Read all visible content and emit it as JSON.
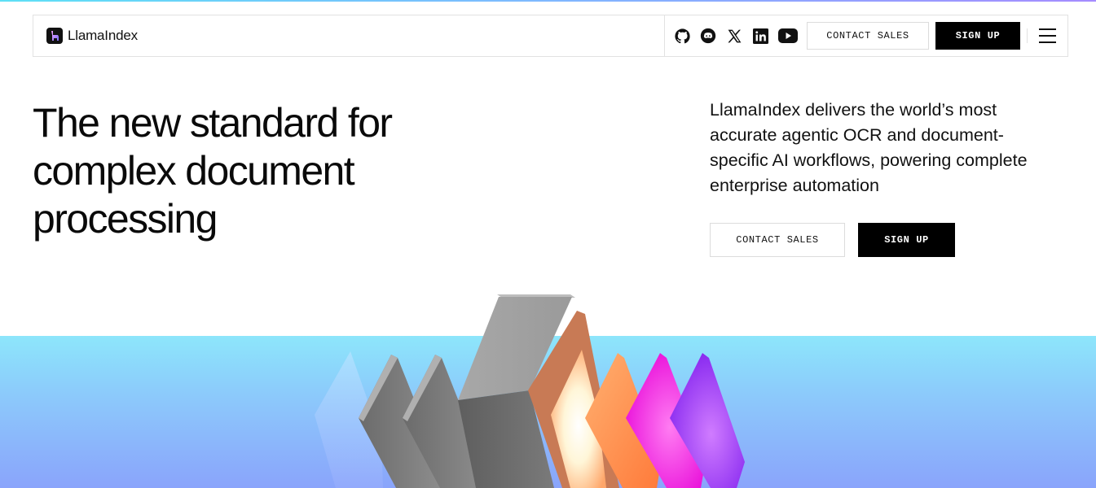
{
  "brand": {
    "name": "LlamaIndex"
  },
  "nav": {
    "social": [
      "github-icon",
      "discord-icon",
      "x-icon",
      "linkedin-icon",
      "youtube-icon"
    ],
    "contact_label": "CONTACT SALES",
    "signup_label": "SIGN UP"
  },
  "hero": {
    "headline_lines": [
      "The new standard for",
      "complex document",
      "processing"
    ],
    "subcopy_lines": [
      "LlamaIndex delivers the world’s most",
      "accurate agentic OCR and document-",
      "specific AI workflows, powering complete",
      "enterprise automation"
    ],
    "contact_label": "CONTACT SALES",
    "signup_label": "SIGN UP"
  },
  "colors": {
    "accent_cyan": "#8de6fb",
    "accent_violet": "#8aa4fb",
    "orange_panel": "#ff8a3d",
    "magenta_panel": "#f21de0",
    "purple_panel": "#9b36f5"
  }
}
